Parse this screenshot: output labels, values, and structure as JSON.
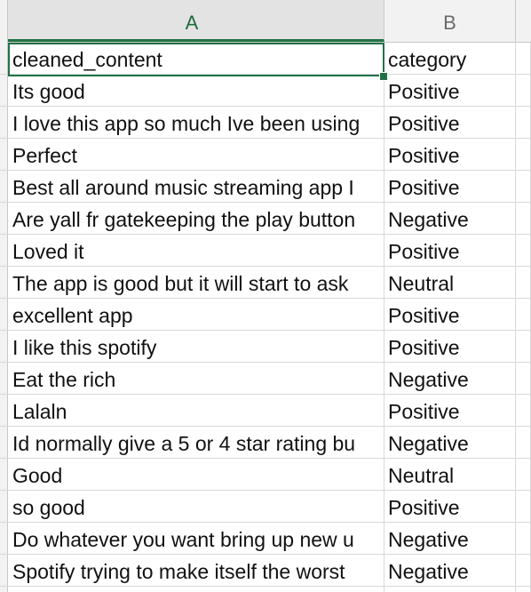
{
  "columns": [
    "A",
    "B"
  ],
  "header_row": {
    "a": "cleaned_content",
    "b": "category"
  },
  "rows": [
    {
      "a": "Its good",
      "b": "Positive"
    },
    {
      "a": "I love this app so much Ive been using",
      "b": "Positive"
    },
    {
      "a": "Perfect",
      "b": "Positive"
    },
    {
      "a": "Best all around music streaming app I",
      "b": "Positive"
    },
    {
      "a": "Are yall fr gatekeeping the play button",
      "b": "Negative"
    },
    {
      "a": "Loved it",
      "b": "Positive"
    },
    {
      "a": "The app is good but it will start to ask",
      "b": "Neutral"
    },
    {
      "a": "excellent app",
      "b": "Positive"
    },
    {
      "a": "I like this spotify",
      "b": "Positive"
    },
    {
      "a": "Eat the rich",
      "b": "Negative"
    },
    {
      "a": "Lalaln",
      "b": "Positive"
    },
    {
      "a": "Id normally give a 5 or 4 star rating bu",
      "b": "Negative"
    },
    {
      "a": "Good",
      "b": "Neutral"
    },
    {
      "a": "so good",
      "b": "Positive"
    },
    {
      "a": "Do whatever you want bring up new u",
      "b": "Negative"
    },
    {
      "a": "Spotify trying to make itself the worst",
      "b": "Negative"
    }
  ]
}
